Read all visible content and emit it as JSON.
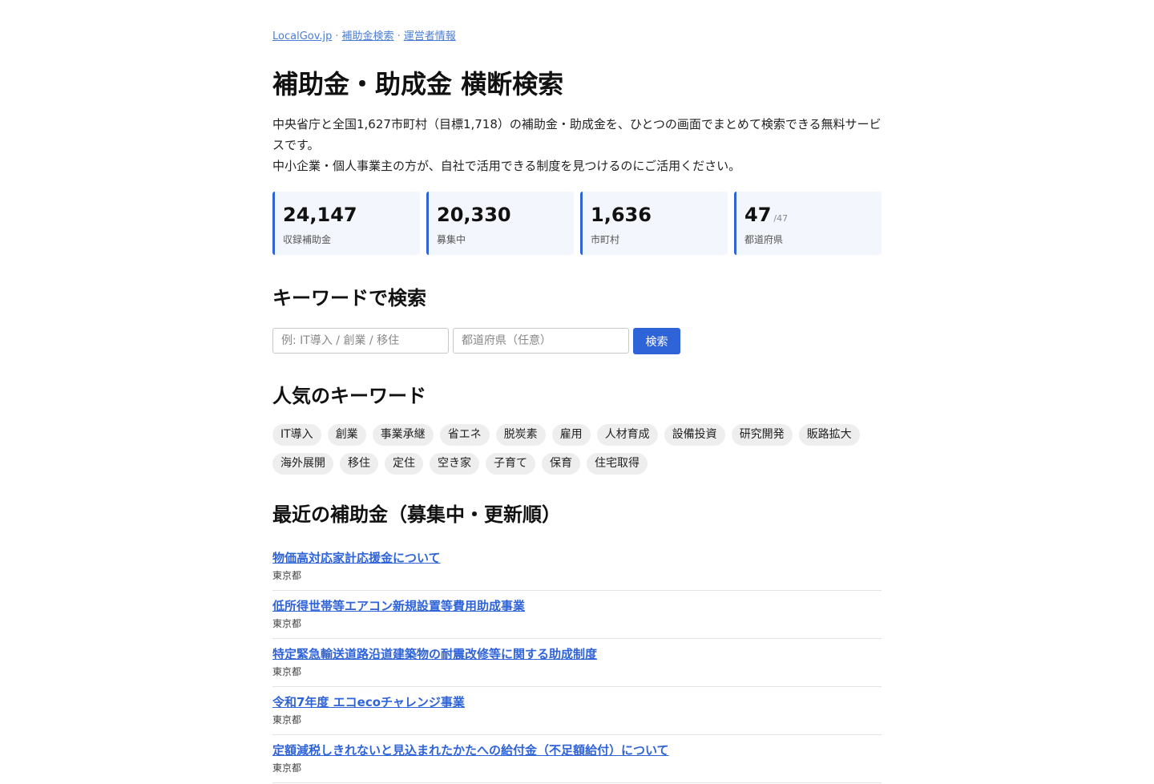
{
  "breadcrumb": {
    "items": [
      "LocalGov.jp",
      "補助金検索",
      "運営者情報"
    ],
    "separator": "·"
  },
  "page_title": "補助金・助成金 横断検索",
  "intro": {
    "line1": "中央省庁と全国1,627市町村（目標1,718）の補助金・助成金を、ひとつの画面でまとめて検索できる無料サービスです。",
    "line2": "中小企業・個人事業主の方が、自社で活用できる制度を見つけるのにご活用ください。"
  },
  "stats": [
    {
      "value": "24,147",
      "sub": "",
      "label": "収録補助金"
    },
    {
      "value": "20,330",
      "sub": "",
      "label": "募集中"
    },
    {
      "value": "1,636",
      "sub": "",
      "label": "市町村"
    },
    {
      "value": "47",
      "sub": "/47",
      "label": "都道府県"
    }
  ],
  "search": {
    "heading": "キーワードで検索",
    "keyword_placeholder": "例: IT導入 / 創業 / 移住",
    "prefecture_placeholder": "都道府県（任意）",
    "button_label": "検索"
  },
  "popular": {
    "heading": "人気のキーワード",
    "row1": [
      "IT導入",
      "創業",
      "事業承継",
      "省エネ",
      "脱炭素",
      "雇用",
      "人材育成",
      "設備投資",
      "研究開発",
      "販路拡大"
    ],
    "row2": [
      "海外展開",
      "移住",
      "定住",
      "空き家",
      "子育て",
      "保育",
      "住宅取得"
    ]
  },
  "recent": {
    "heading": "最近の補助金（募集中・更新順）",
    "items": [
      {
        "title": "物価高対応家計応援金について",
        "prefecture": "東京都"
      },
      {
        "title": "低所得世帯等エアコン新規設置等費用助成事業",
        "prefecture": "東京都"
      },
      {
        "title": "特定緊急輸送道路沿道建築物の耐震改修等に関する助成制度",
        "prefecture": "東京都"
      },
      {
        "title": "令和7年度 エコecoチャレンジ事業",
        "prefecture": "東京都"
      },
      {
        "title": "定額減税しきれないと見込まれたかたへの給付金（不足額給付）について",
        "prefecture": "東京都"
      }
    ]
  }
}
